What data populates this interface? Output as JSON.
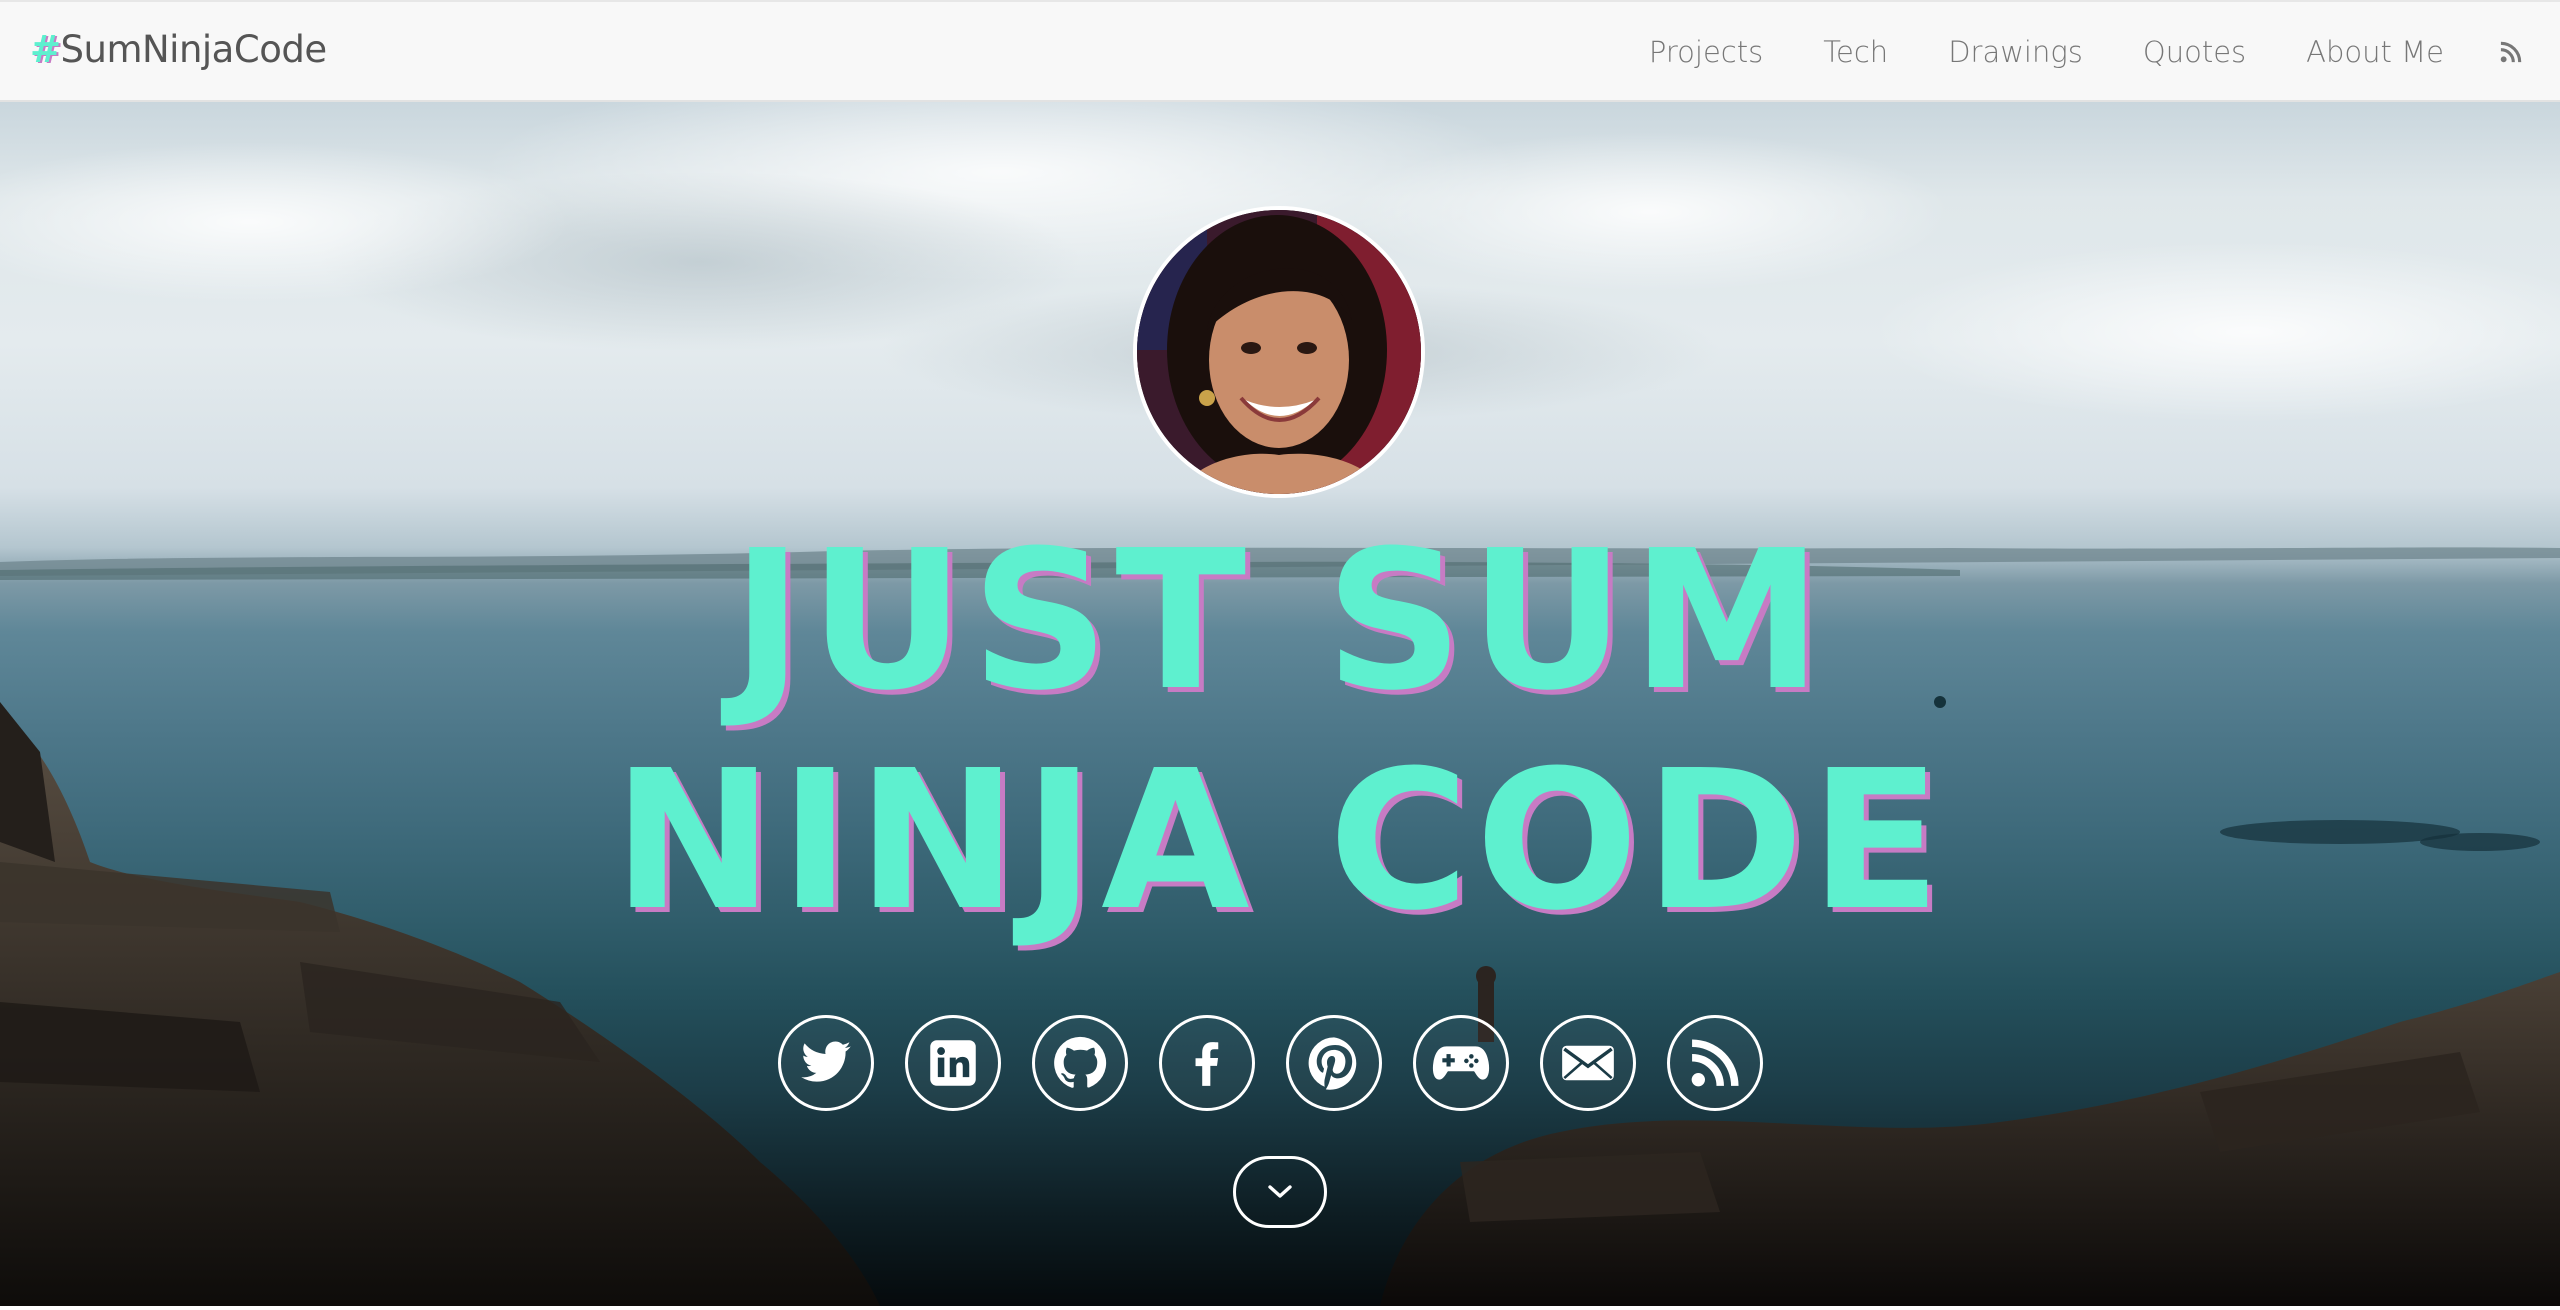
{
  "navbar": {
    "brand_hash": "#",
    "brand_text": "SumNinjaCode",
    "links": [
      {
        "label": "Projects"
      },
      {
        "label": "Tech"
      },
      {
        "label": "Drawings"
      },
      {
        "label": "Quotes"
      },
      {
        "label": "About Me"
      }
    ],
    "rss_icon": "rss-icon"
  },
  "hero": {
    "headline_line1": "JUST SUM",
    "headline_line2": "NINJA CODE",
    "avatar_icon": "profile-photo",
    "socials": [
      {
        "name": "twitter-icon"
      },
      {
        "name": "linkedin-icon"
      },
      {
        "name": "github-icon"
      },
      {
        "name": "facebook-icon"
      },
      {
        "name": "pinterest-icon"
      },
      {
        "name": "gamepad-icon"
      },
      {
        "name": "email-icon"
      },
      {
        "name": "rss-icon"
      }
    ],
    "scroll_icon": "chevron-down-icon"
  },
  "colors": {
    "accent": "#5ef0cf",
    "accent_shadow": "#c77bc4",
    "nav_text": "#777777",
    "nav_background": "#f8f8f8"
  }
}
